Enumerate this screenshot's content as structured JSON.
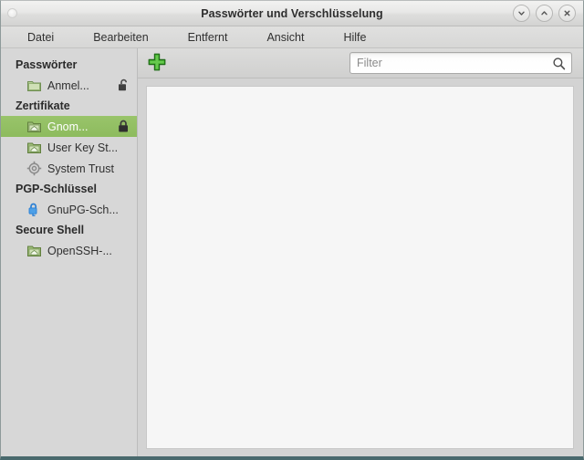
{
  "window": {
    "title": "Passwörter und Verschlüsselung",
    "menu_dot": "window-menu-dot",
    "buttons": {
      "minimize": "minimize-icon",
      "maximize": "maximize-icon",
      "close": "close-icon"
    }
  },
  "menubar": {
    "items": [
      {
        "label": "Datei"
      },
      {
        "label": "Bearbeiten"
      },
      {
        "label": "Entfernt"
      },
      {
        "label": "Ansicht"
      },
      {
        "label": "Hilfe"
      }
    ]
  },
  "toolbar": {
    "add_icon": "plus-icon",
    "filter": {
      "value": "",
      "placeholder": "Filter",
      "icon": "search-icon"
    }
  },
  "sidebar": {
    "groups": [
      {
        "header": "Passwörter",
        "items": [
          {
            "label": "Anmel...",
            "icon": "keyring-folder-icon",
            "lock": "unlocked-padlock-icon",
            "selected": false
          }
        ]
      },
      {
        "header": "Zertifikate",
        "items": [
          {
            "label": "Gnom...",
            "icon": "certificate-keyring-icon",
            "lock": "locked-padlock-icon",
            "selected": true
          },
          {
            "label": "User Key St...",
            "icon": "certificate-keyring-icon",
            "lock": "",
            "selected": false
          },
          {
            "label": "System Trust",
            "icon": "gear-icon",
            "lock": "",
            "selected": false
          }
        ]
      },
      {
        "header": "PGP-Schlüssel",
        "items": [
          {
            "label": "GnuPG-Sch...",
            "icon": "blue-padlock-icon",
            "lock": "",
            "selected": false
          }
        ]
      },
      {
        "header": "Secure Shell",
        "items": [
          {
            "label": "OpenSSH-...",
            "icon": "certificate-keyring-icon",
            "lock": "",
            "selected": false
          }
        ]
      }
    ]
  },
  "main": {
    "list_empty": true
  },
  "colors": {
    "selection_green": "#93c064",
    "window_border": "#49696d",
    "sidebar_bg": "#d7d7d7",
    "content_bg": "#f6f6f6",
    "add_icon_green": "#3faa2c",
    "pgp_icon_blue": "#2a7fd4"
  }
}
